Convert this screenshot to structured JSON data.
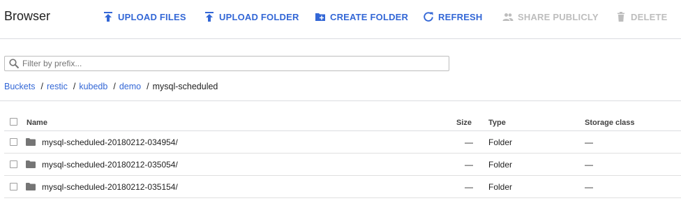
{
  "header": {
    "title": "Browser",
    "toolbar": {
      "upload_files": "UPLOAD FILES",
      "upload_folder": "UPLOAD FOLDER",
      "create_folder": "CREATE FOLDER",
      "refresh": "REFRESH",
      "share_publicly": "SHARE PUBLICLY",
      "delete": "DELETE"
    }
  },
  "filter": {
    "placeholder": "Filter by prefix...",
    "value": ""
  },
  "breadcrumb": {
    "items": [
      "Buckets",
      "restic",
      "kubedb",
      "demo"
    ],
    "separator": "/",
    "current": "mysql-scheduled"
  },
  "table": {
    "columns": [
      "Name",
      "Size",
      "Type",
      "Storage class"
    ],
    "rows": [
      {
        "name": "mysql-scheduled-20180212-034954/",
        "size": "—",
        "type": "Folder",
        "storage_class": "—"
      },
      {
        "name": "mysql-scheduled-20180212-035054/",
        "size": "—",
        "type": "Folder",
        "storage_class": "—"
      },
      {
        "name": "mysql-scheduled-20180212-035154/",
        "size": "—",
        "type": "Folder",
        "storage_class": "—"
      }
    ]
  },
  "colors": {
    "accent": "#3367d6",
    "disabled": "#bdbdbd",
    "folder_icon": "#757575",
    "divider": "#dadce0"
  },
  "icons": [
    "upload-icon",
    "upload-icon",
    "create-folder-icon",
    "refresh-icon",
    "share-people-icon",
    "trash-icon",
    "search-icon",
    "folder-icon"
  ]
}
